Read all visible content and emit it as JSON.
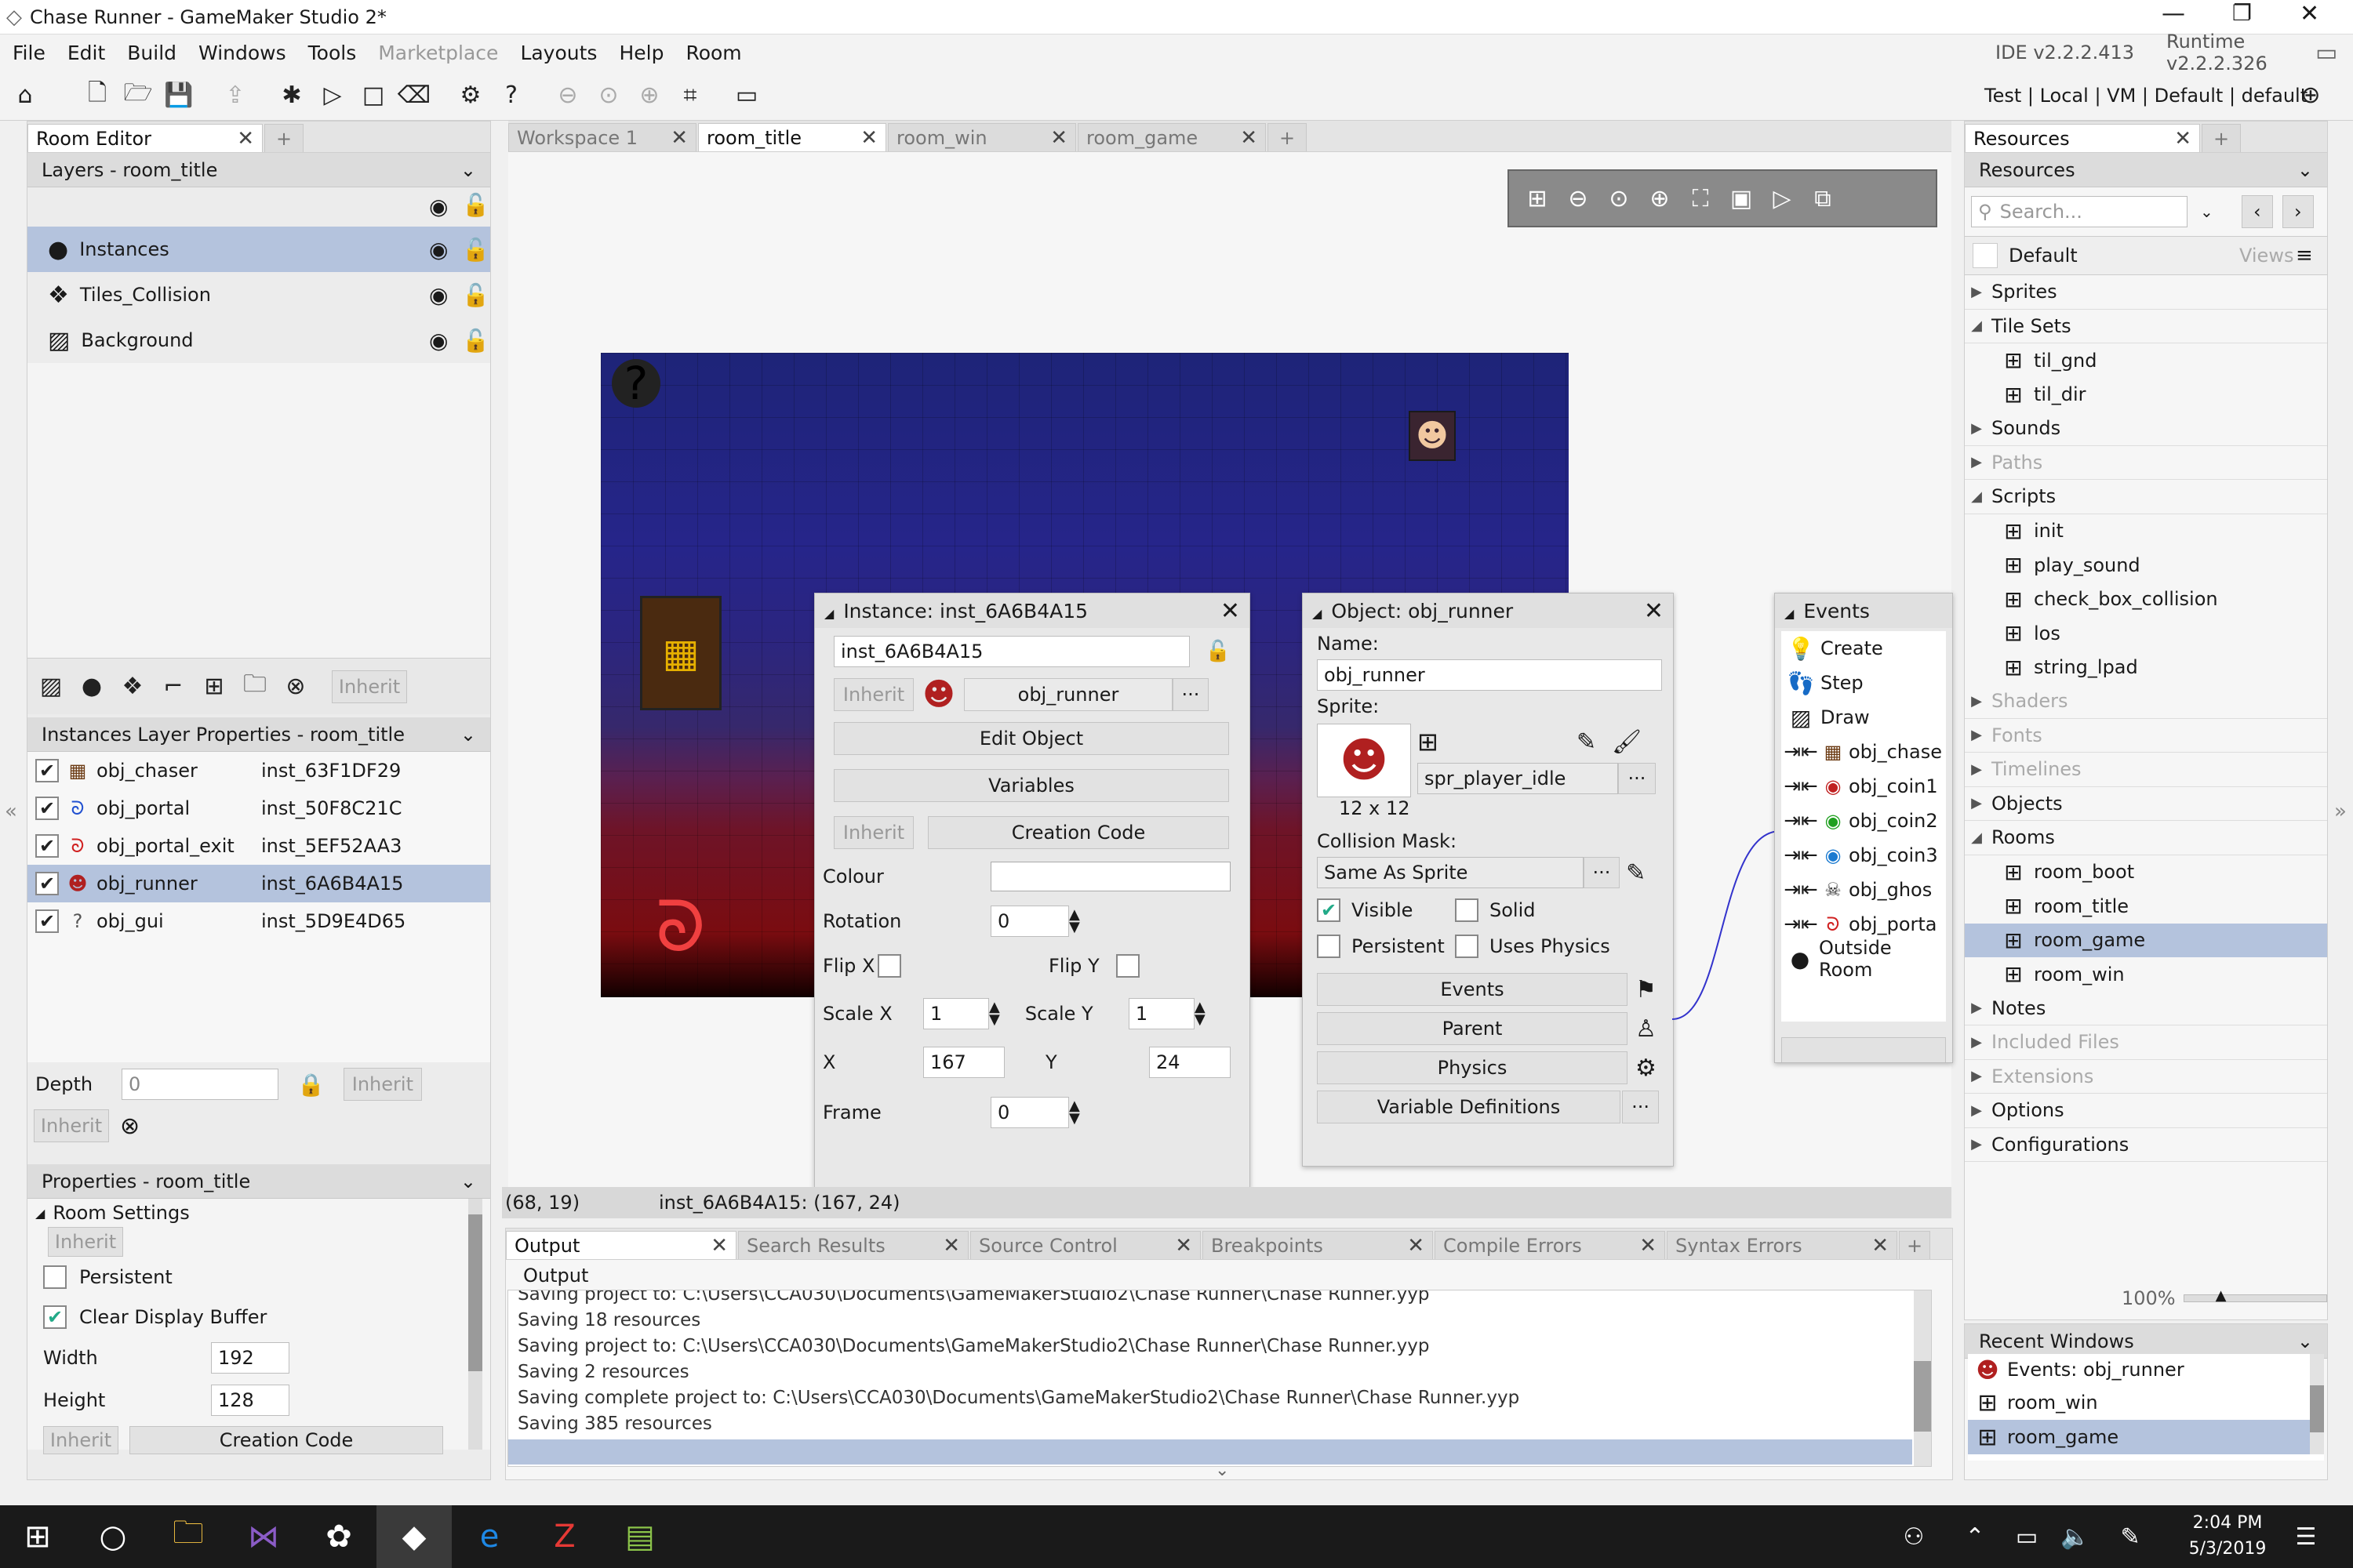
{
  "window": {
    "title": "Chase Runner - GameMaker Studio 2*"
  },
  "menu": [
    "File",
    "Edit",
    "Build",
    "Windows",
    "Tools",
    "Marketplace",
    "Layouts",
    "Help",
    "Room"
  ],
  "menu_disabled": "Marketplace",
  "version": {
    "ide": "IDE v2.2.2.413",
    "runtime": "Runtime v2.2.2.326"
  },
  "target": "Test | Local | VM | Default | default",
  "left": {
    "tab": "Room Editor",
    "layers_title": "Layers - room_title",
    "layers": [
      "Instances",
      "Tiles_Collision",
      "Background"
    ],
    "inherit": "Inherit",
    "instances_title": "Instances Layer Properties - room_title",
    "instances": [
      {
        "obj": "obj_chaser",
        "inst": "inst_63F1DF29"
      },
      {
        "obj": "obj_portal",
        "inst": "inst_50F8C21C"
      },
      {
        "obj": "obj_portal_exit",
        "inst": "inst_5EF52AA3"
      },
      {
        "obj": "obj_runner",
        "inst": "inst_6A6B4A15"
      },
      {
        "obj": "obj_gui",
        "inst": "inst_5D9E4D65"
      }
    ],
    "depth_label": "Depth",
    "depth_value": "0",
    "props_title": "Properties - room_title",
    "room_settings": "Room Settings",
    "persistent": "Persistent",
    "clear_display": "Clear Display Buffer",
    "width_label": "Width",
    "width_value": "192",
    "height_label": "Height",
    "height_value": "128",
    "creation_code": "Creation Code"
  },
  "center_tabs": [
    "Workspace 1",
    "room_title",
    "room_win",
    "room_game"
  ],
  "instance_dlg": {
    "title": "Instance: inst_6A6B4A15",
    "name": "inst_6A6B4A15",
    "inherit": "Inherit",
    "object": "obj_runner",
    "edit_object": "Edit Object",
    "variables": "Variables",
    "creation_code": "Creation Code",
    "colour": "Colour",
    "rotation": "Rotation",
    "rotation_value": "0",
    "flip_x": "Flip X",
    "flip_y": "Flip Y",
    "scale_x": "Scale X",
    "scale_x_value": "1",
    "scale_y": "Scale Y",
    "scale_y_value": "1",
    "x": "X",
    "x_value": "167",
    "y": "Y",
    "y_value": "24",
    "frame": "Frame",
    "frame_value": "0"
  },
  "object_dlg": {
    "title": "Object: obj_runner",
    "name_label": "Name:",
    "name": "obj_runner",
    "sprite_label": "Sprite:",
    "sprite": "spr_player_idle",
    "sprite_size": "12 x 12",
    "collision_label": "Collision Mask:",
    "collision": "Same As Sprite",
    "visible": "Visible",
    "solid": "Solid",
    "persistent": "Persistent",
    "uses_physics": "Uses Physics",
    "events": "Events",
    "parent": "Parent",
    "physics": "Physics",
    "variable_defs": "Variable Definitions"
  },
  "events_dlg": {
    "title": "Events",
    "items": [
      "Create",
      "Step",
      "Draw",
      "obj_chase",
      "obj_coin1",
      "obj_coin2",
      "obj_coin3",
      "obj_ghos",
      "obj_porta",
      "Outside Room"
    ]
  },
  "status": {
    "coords": "(68, 19)",
    "info": "inst_6A6B4A15: (167, 24)"
  },
  "bottom_tabs": [
    "Output",
    "Search Results",
    "Source Control",
    "Breakpoints",
    "Compile Errors",
    "Syntax Errors"
  ],
  "output": {
    "title": "Output",
    "lines": [
      "Saving project to: C:\\Users\\CCA030\\Documents\\GameMakerStudio2\\Chase Runner\\Chase Runner.yyp",
      "Saving 18 resources",
      "Saving project to: C:\\Users\\CCA030\\Documents\\GameMakerStudio2\\Chase Runner\\Chase Runner.yyp",
      "Saving 2 resources",
      "Saving complete project to: C:\\Users\\CCA030\\Documents\\GameMakerStudio2\\Chase Runner\\Chase Runner.yyp",
      "Saving 385 resources"
    ]
  },
  "resources": {
    "tab": "Resources",
    "title": "Resources",
    "search_placeholder": "Search...",
    "default": "Default",
    "views": "Views",
    "tree": [
      {
        "label": "Sprites",
        "level": 0,
        "open": false
      },
      {
        "label": "Tile Sets",
        "level": 0,
        "open": true
      },
      {
        "label": "til_gnd",
        "level": 1
      },
      {
        "label": "til_dir",
        "level": 1
      },
      {
        "label": "Sounds",
        "level": 0,
        "open": false
      },
      {
        "label": "Paths",
        "level": 0,
        "dim": true
      },
      {
        "label": "Scripts",
        "level": 0,
        "open": true
      },
      {
        "label": "init",
        "level": 1
      },
      {
        "label": "play_sound",
        "level": 1
      },
      {
        "label": "check_box_collision",
        "level": 1
      },
      {
        "label": "los",
        "level": 1
      },
      {
        "label": "string_lpad",
        "level": 1
      },
      {
        "label": "Shaders",
        "level": 0,
        "dim": true
      },
      {
        "label": "Fonts",
        "level": 0,
        "dim": true
      },
      {
        "label": "Timelines",
        "level": 0,
        "dim": true
      },
      {
        "label": "Objects",
        "level": 0,
        "open": false
      },
      {
        "label": "Rooms",
        "level": 0,
        "open": true
      },
      {
        "label": "room_boot",
        "level": 1
      },
      {
        "label": "room_title",
        "level": 1
      },
      {
        "label": "room_game",
        "level": 1,
        "sel": true
      },
      {
        "label": "room_win",
        "level": 1
      },
      {
        "label": "Notes",
        "level": 0
      },
      {
        "label": "Included Files",
        "level": 0,
        "dim": true
      },
      {
        "label": "Extensions",
        "level": 0,
        "dim": true
      },
      {
        "label": "Options",
        "level": 0
      },
      {
        "label": "Configurations",
        "level": 0
      }
    ],
    "zoom": "100%"
  },
  "recent": {
    "title": "Recent Windows",
    "items": [
      "Events: obj_runner",
      "room_win",
      "room_game"
    ]
  },
  "clock": {
    "time": "2:04 PM",
    "date": "5/3/2019"
  }
}
